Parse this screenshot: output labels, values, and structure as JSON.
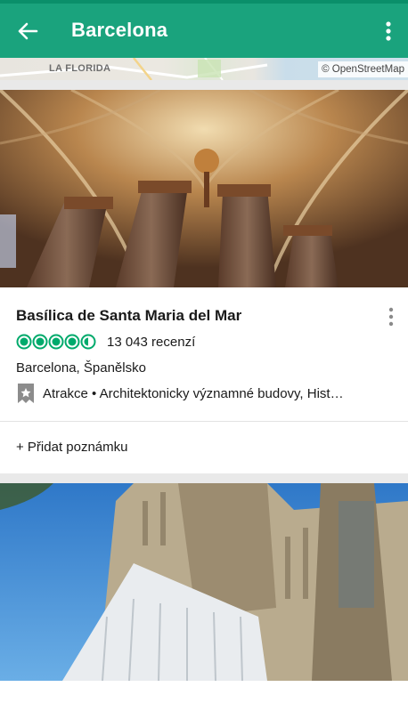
{
  "app_bar": {
    "title": "Barcelona",
    "back_icon": "arrow-left-icon",
    "more_icon": "more-vert-icon"
  },
  "map": {
    "district_label": "LA FLORIDA",
    "attribution": "© OpenStreetMap"
  },
  "results": [
    {
      "name": "Basílica de Santa Maria del Mar",
      "rating": 4.5,
      "reviews": "13 043 recenzí",
      "location": "Barcelona, Španělsko",
      "category": "Atrakce • Architektonicky významné budovy, Hist…",
      "add_note": "+ Přidat poznámku"
    }
  ],
  "colors": {
    "brand": "#1aa37d",
    "rating": "#00aa6c"
  }
}
